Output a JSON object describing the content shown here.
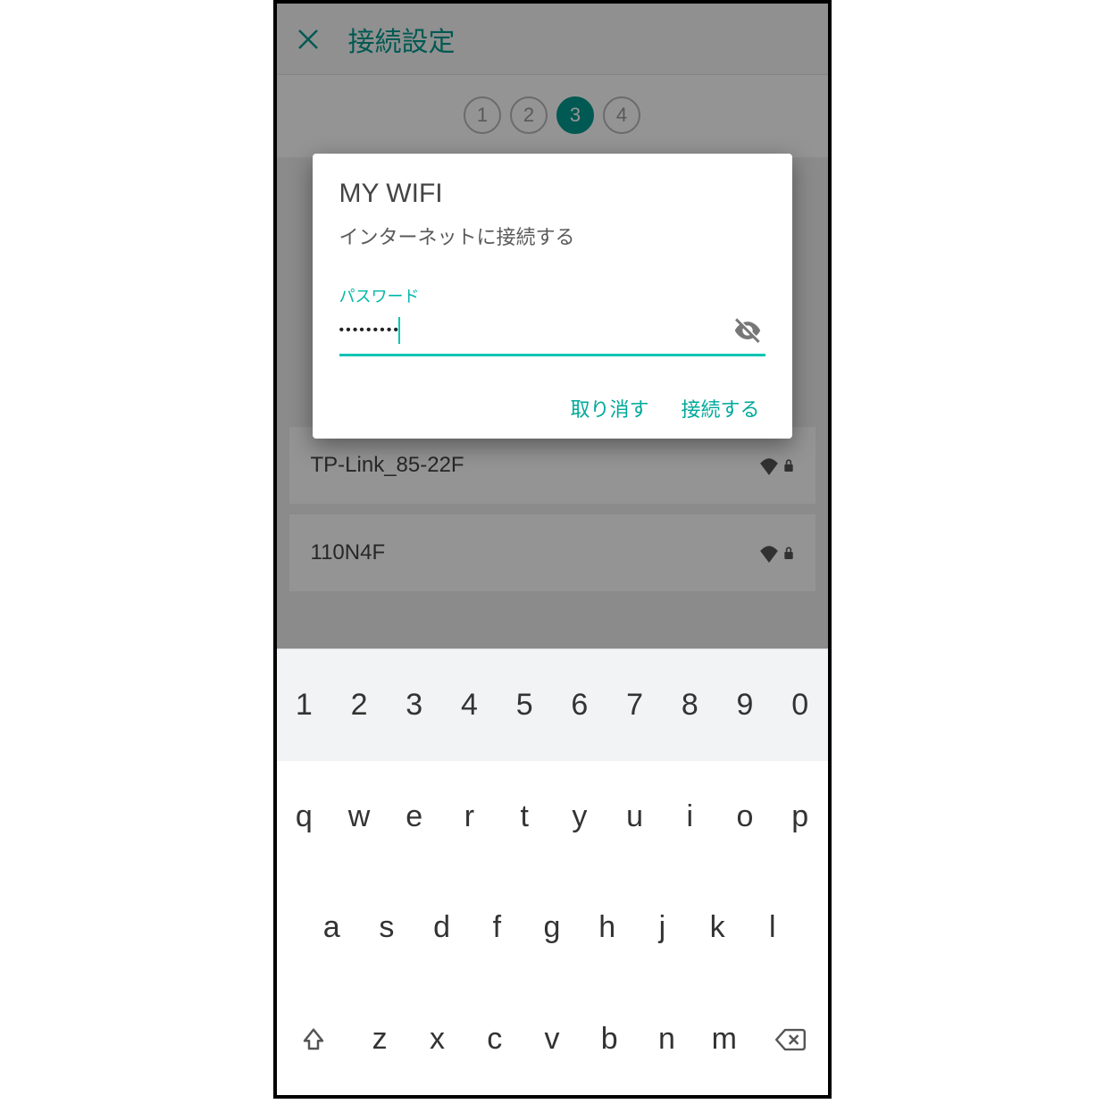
{
  "header": {
    "title": "接続設定"
  },
  "stepper": {
    "steps": [
      "1",
      "2",
      "3",
      "4"
    ],
    "active_index": 2
  },
  "networks": [
    {
      "ssid": "TP-Link_85-22F",
      "secured": true
    },
    {
      "ssid": "110N4F",
      "secured": true
    }
  ],
  "dialog": {
    "title": "MY WIFI",
    "subtitle": "インターネットに接続する",
    "password_label": "パスワード",
    "password_masked": "•••••••••",
    "cancel_label": "取り消す",
    "connect_label": "接続する"
  },
  "keyboard": {
    "row_num": [
      "1",
      "2",
      "3",
      "4",
      "5",
      "6",
      "7",
      "8",
      "9",
      "0"
    ],
    "row_top": [
      "q",
      "w",
      "e",
      "r",
      "t",
      "y",
      "u",
      "i",
      "o",
      "p"
    ],
    "row_mid": [
      "a",
      "s",
      "d",
      "f",
      "g",
      "h",
      "j",
      "k",
      "l"
    ],
    "row_bot": [
      "z",
      "x",
      "c",
      "v",
      "b",
      "n",
      "m"
    ]
  }
}
